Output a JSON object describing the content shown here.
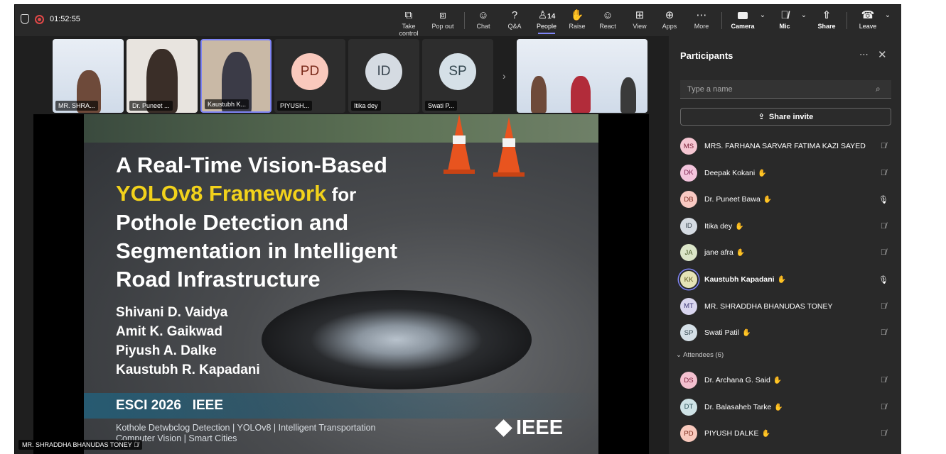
{
  "top_bar": {
    "timer": "01:52:55",
    "buttons": [
      {
        "label": "Take control",
        "icon": "take-control-icon"
      },
      {
        "label": "Pop out",
        "icon": "pop-out-icon"
      },
      {
        "label": "Chat",
        "icon": "chat-icon"
      },
      {
        "label": "Q&A",
        "icon": "qa-icon"
      },
      {
        "label": "People",
        "icon": "people-icon",
        "count": "14",
        "active": true
      },
      {
        "label": "Raise",
        "icon": "raise-hand-icon"
      },
      {
        "label": "React",
        "icon": "react-icon"
      },
      {
        "label": "View",
        "icon": "view-icon"
      },
      {
        "label": "Apps",
        "icon": "apps-icon"
      },
      {
        "label": "More",
        "icon": "more-icon"
      },
      {
        "label": "Camera",
        "icon": "camera-icon"
      },
      {
        "label": "Mic",
        "icon": "mic-off-icon"
      },
      {
        "label": "Share",
        "icon": "share-icon"
      },
      {
        "label": "Leave",
        "icon": "leave-icon"
      }
    ]
  },
  "gallery": [
    {
      "name": "MR. SHRA...",
      "type": "video"
    },
    {
      "name": "Dr. Puneet ...",
      "type": "video"
    },
    {
      "name": "Kaustubh K...",
      "type": "video",
      "selected": true
    },
    {
      "name": "PIYUSH...",
      "type": "avatar",
      "initials": "PD",
      "color": "#f9c9bd",
      "text_color": "#7a2a1a"
    },
    {
      "name": "Itika dey",
      "type": "avatar",
      "initials": "ID",
      "color": "#d5dbe2",
      "text_color": "#3a4650"
    },
    {
      "name": "Swati P...",
      "type": "avatar",
      "initials": "SP",
      "color": "#d5e0e7",
      "text_color": "#34474f"
    }
  ],
  "slide": {
    "title_line1": "A Real-Time Vision-Based",
    "title_highlight": "YOLOv8 Framework",
    "title_rest_line2": " for",
    "title_line3": "Pothole Detection and",
    "title_line4": "Segmentation in Intelligent",
    "title_line5": "Road Infrastructure",
    "authors": [
      "Shivani D. Vaidya",
      "Amit K. Gaikwad",
      "Piyush A. Dalke",
      "Kaustubh R. Kapadani"
    ],
    "conference": "ESCI 2026   IEEE",
    "tags_line1": "Kothole Detwbclog Detection | YOLOv8 | Intelligent Transportation",
    "tags_line2": "Computer Vision | Smart Cities",
    "logo_text": "IEEE"
  },
  "speaker_label": "MR. SHRADDHA BHANUDAS TONEY",
  "participants": {
    "title": "Participants",
    "search_placeholder": "Type a name",
    "share_invite": "Share invite",
    "attendees_label": "Attendees (6)",
    "presenters": [
      {
        "initials": "MS",
        "name": "MRS. FARHANA SARVAR FATIMA KAZI SAYED",
        "hand": false,
        "mic": "off",
        "color": "#f5c6d2",
        "text_color": "#7a2038"
      },
      {
        "initials": "DK",
        "name": "Deepak Kokani",
        "hand": true,
        "mic": "off",
        "color": "#f3c4dc",
        "text_color": "#7a1f4d"
      },
      {
        "initials": "DB",
        "name": "Dr. Puneet Bawa",
        "hand": true,
        "mic": "on",
        "color": "#f8c9c2",
        "text_color": "#7a2a20"
      },
      {
        "initials": "ID",
        "name": "Itika dey",
        "hand": true,
        "mic": "off",
        "color": "#d5dbe2",
        "text_color": "#3a4650"
      },
      {
        "initials": "JA",
        "name": "jane afra",
        "hand": true,
        "mic": "off",
        "color": "#dbe5c8",
        "text_color": "#475a26"
      },
      {
        "initials": "KK",
        "name": "Kaustubh Kapadani",
        "hand": true,
        "mic": "on",
        "color": "#e6e3b6",
        "text_color": "#5b5520",
        "bold": true,
        "ring": true
      },
      {
        "initials": "MT",
        "name": "MR. SHRADDHA BHANUDAS TONEY",
        "hand": false,
        "mic": "off",
        "color": "#d9d6ef",
        "text_color": "#3f3a78"
      },
      {
        "initials": "SP",
        "name": "Swati Patil",
        "hand": true,
        "mic": "off",
        "color": "#d5e0e7",
        "text_color": "#34474f"
      }
    ],
    "attendees": [
      {
        "initials": "DS",
        "name": "Dr. Archana G. Said",
        "hand": true,
        "mic": "off",
        "color": "#f3c0cf",
        "text_color": "#7a1f3a"
      },
      {
        "initials": "DT",
        "name": "Dr. Balasaheb Tarke",
        "hand": true,
        "mic": "off",
        "color": "#cfe3e6",
        "text_color": "#2b5158"
      },
      {
        "initials": "PD",
        "name": "PIYUSH DALKE",
        "hand": true,
        "mic": "off",
        "color": "#f9c9bd",
        "text_color": "#7a2a1a"
      }
    ]
  }
}
